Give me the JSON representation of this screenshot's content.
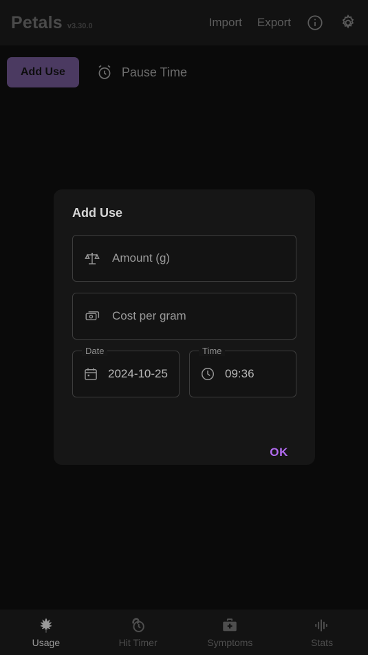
{
  "app": {
    "name": "Petals",
    "version": "v3.30.0"
  },
  "header": {
    "import_label": "Import",
    "export_label": "Export",
    "info_icon": "info-circle-icon",
    "settings_icon": "gear-icon"
  },
  "toolbar": {
    "add_use_label": "Add Use",
    "pause_time_label": "Pause Time",
    "pause_icon": "alarm-clock-icon",
    "add_use_bg": "#4b3a61"
  },
  "dialog": {
    "title": "Add Use",
    "amount": {
      "placeholder": "Amount (g)",
      "value": "",
      "icon": "scale-balance-icon"
    },
    "cost": {
      "placeholder": "Cost per gram",
      "value": "",
      "icon": "money-bill-icon"
    },
    "date": {
      "legend": "Date",
      "value": "2024-10-25",
      "icon": "calendar-icon"
    },
    "time": {
      "legend": "Time",
      "value": "09:36",
      "icon": "clock-icon"
    },
    "ok_label": "OK",
    "ok_color": "#b26bf0"
  },
  "bottom_nav": {
    "items": [
      {
        "label": "Usage",
        "icon": "cannabis-leaf-icon",
        "active": true
      },
      {
        "label": "Hit Timer",
        "icon": "stopwatch-icon",
        "active": false
      },
      {
        "label": "Symptoms",
        "icon": "medical-bag-icon",
        "active": false
      },
      {
        "label": "Stats",
        "icon": "equalizer-bars-icon",
        "active": false
      }
    ]
  }
}
